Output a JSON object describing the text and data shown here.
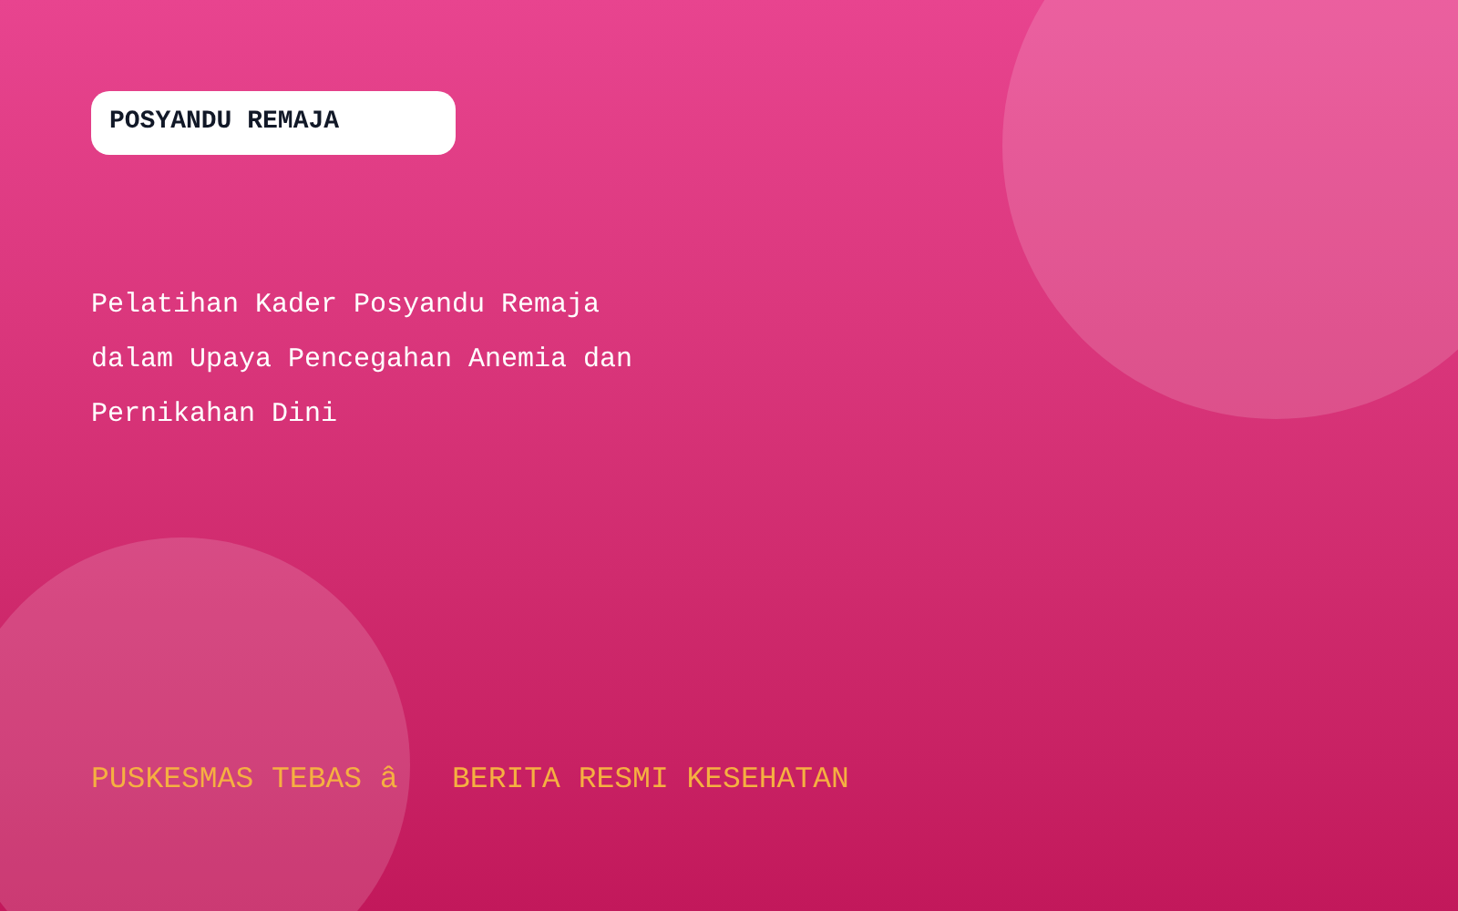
{
  "badge": {
    "label": "POSYANDU REMAJA"
  },
  "title_lines": [
    "Pelatihan Kader Posyandu Remaja",
    "dalam Upaya Pencegahan Anemia dan",
    "Pernikahan Dini"
  ],
  "footer": {
    "text": "PUSKESMAS TEBAS â   BERITA RESMI KESEHATAN"
  }
}
